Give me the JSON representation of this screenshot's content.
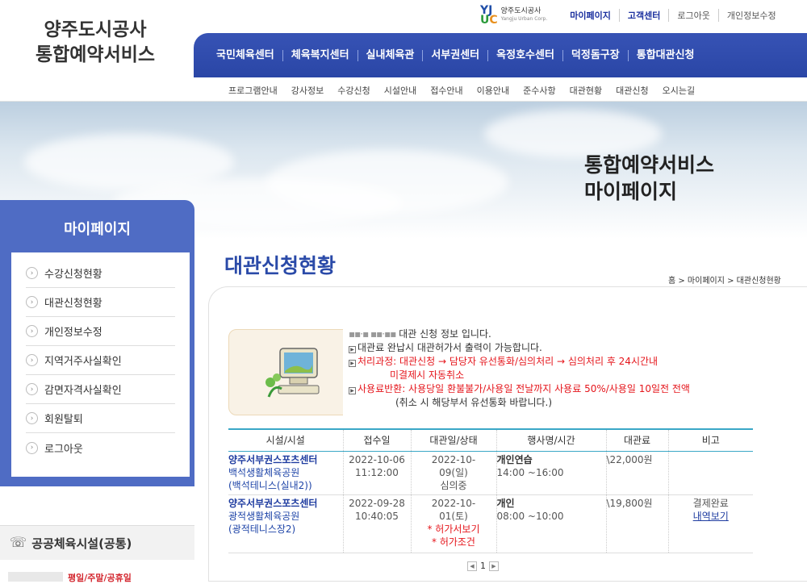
{
  "header": {
    "site_title_line1": "양주도시공사",
    "site_title_line2": "통합예약서비스",
    "corp_logo_text": "양주도시공사",
    "corp_logo_sub": "Yangju Urban Corp.",
    "top_links": [
      "마이페이지",
      "고객센터",
      "로그아웃",
      "개인정보수정"
    ]
  },
  "gnb": [
    "국민체육센터",
    "체육복지센터",
    "실내체육관",
    "서부권센터",
    "옥정호수센터",
    "덕정돔구장",
    "통합대관신청"
  ],
  "subnav": [
    "프로그램안내",
    "강사정보",
    "수강신청",
    "시설안내",
    "접수안내",
    "이용안내",
    "준수사항",
    "대관현황",
    "대관신청",
    "오시는길"
  ],
  "hero": {
    "line1": "통합예약서비스",
    "line2": "마이페이지"
  },
  "sidebar": {
    "title": "마이페이지",
    "items": [
      "수강신청현황",
      "대관신청현황",
      "개인정보수정",
      "지역거주사실확인",
      "감면자격사실확인",
      "회원탈퇴",
      "로그아웃"
    ],
    "facility_title": "공공체육시설(공통)",
    "facility_foot": "평일/주말/공휴일"
  },
  "main": {
    "page_title": "대관신청현황",
    "breadcrumb": "홈 > 마이페이지 > 대관신청현황",
    "info": {
      "line1_suffix": "대관 신청 정보 입니다.",
      "line2": "대관료 완납시 대관허가서 출력이 가능합니다.",
      "line3": "처리과정: 대관신청 → 담당자 유선통화/심의처리 → 심의처리 후 24시간내",
      "line4": "미결제시 자동취소",
      "line5": "사용료반환: 사용당일 환불불가/사용일 전날까지 사용료 50%/사용일 10일전 전액",
      "line6": "(취소 시 해당부서 유선통화 바랍니다.)"
    },
    "table": {
      "headers": [
        "시설/시설",
        "접수일",
        "대관일/상태",
        "행사명/시간",
        "대관료",
        "비고"
      ],
      "rows": [
        {
          "center": "양주서부권스포츠센터",
          "facility": "백석생활체육공원",
          "court": "(백석테니스(실내2))",
          "recv_date": "2022-10-06",
          "recv_time": "11:12:00",
          "use_date1": "2022-10-",
          "use_date2": "09(일)",
          "status": "심의중",
          "event": "개인연습",
          "time": "14:00 ~16:00",
          "fee": "\\22,000원",
          "note": "",
          "note_link": ""
        },
        {
          "center": "양주서부권스포츠센터",
          "facility": "광적생활체육공원",
          "court": "(광적테니스장2)",
          "recv_date": "2022-09-28",
          "recv_time": "10:40:05",
          "use_date1": "2022-10-",
          "use_date2": "01(토)",
          "status1": "* 허가서보기",
          "status2": "* 허가조건",
          "event": "개인",
          "time": "08:00 ~10:00",
          "fee": "\\19,800원",
          "note": "결제완료",
          "note_link": "내역보기"
        }
      ]
    },
    "pager": {
      "current": "1"
    }
  }
}
